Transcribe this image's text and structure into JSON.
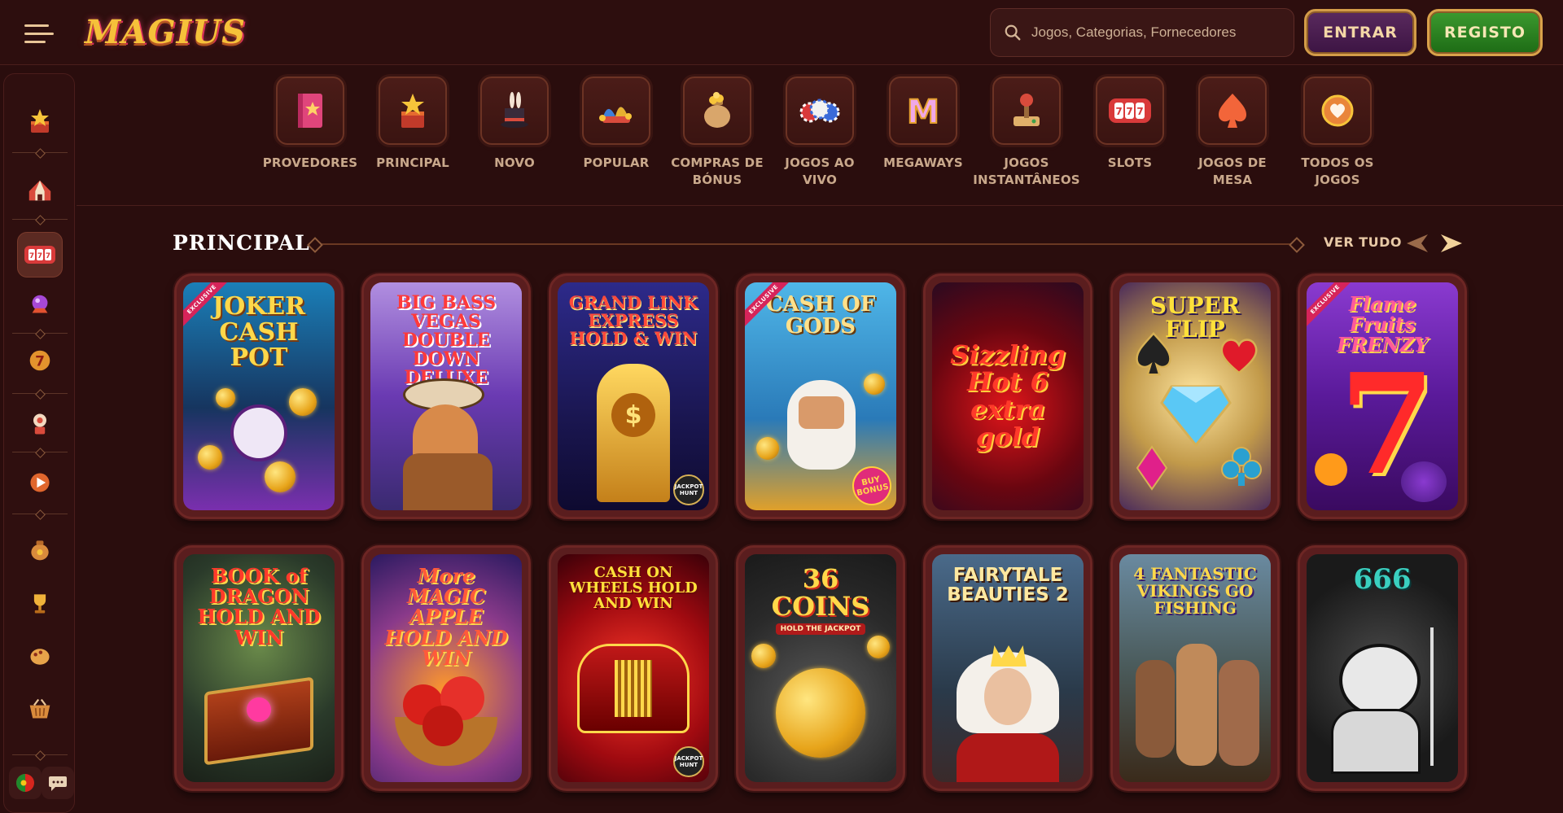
{
  "header": {
    "logo_text": "MAGIUS",
    "search_placeholder": "Jogos, Categorias, Fornecedores",
    "enter_label": "ENTRAR",
    "register_label": "REGISTO"
  },
  "categories": [
    {
      "label": "PROVEDORES",
      "icon": "book-star-icon"
    },
    {
      "label": "PRINCIPAL",
      "icon": "jack-in-box-icon"
    },
    {
      "label": "NOVO",
      "icon": "magic-hat-icon"
    },
    {
      "label": "POPULAR",
      "icon": "jester-hat-icon"
    },
    {
      "label": "COMPRAS DE BÓNUS",
      "icon": "coin-bag-icon"
    },
    {
      "label": "JOGOS AO VIVO",
      "icon": "poker-chips-icon"
    },
    {
      "label": "MEGAWAYS",
      "icon": "megaways-m-icon"
    },
    {
      "label": "JOGOS INSTANTÂNEOS",
      "icon": "joystick-icon"
    },
    {
      "label": "SLOTS",
      "icon": "slot-reels-icon"
    },
    {
      "label": "JOGOS DE MESA",
      "icon": "spade-icon"
    },
    {
      "label": "TODOS OS JOGOS",
      "icon": "heart-chip-icon"
    }
  ],
  "section": {
    "title": "PRINCIPAL",
    "see_all": "VER TUDO"
  },
  "games": [
    {
      "title": "JOKER CASH POT",
      "exclusive": "EXCLUSIVE"
    },
    {
      "title": "BIG BASS VEGAS DOUBLE DOWN DELUXE"
    },
    {
      "title": "GRAND LINK EXPRESS HOLD & WIN",
      "badge": "JACKPOT HUNT"
    },
    {
      "title": "CASH OF GODS",
      "exclusive": "EXCLUSIVE",
      "badge": "BUY BONUS"
    },
    {
      "title": "Sizzling Hot 6 extra gold"
    },
    {
      "title": "SUPER FLIP"
    },
    {
      "title": "Flame Fruits FRENZY",
      "exclusive": "EXCLUSIVE"
    },
    {
      "title": "BOOK of DRAGON HOLD AND WIN"
    },
    {
      "title": "More MAGIC APPLE HOLD AND WIN"
    },
    {
      "title": "CASH ON WHEELS HOLD AND WIN",
      "badge": "JACKPOT HUNT"
    },
    {
      "title": "36 COINS",
      "subtitle": "HOLD THE JACKPOT"
    },
    {
      "title": "FAIRYTALE BEAUTIES 2"
    },
    {
      "title": "4 FANTASTIC VIKINGS GO FISHING"
    },
    {
      "title": "666"
    }
  ],
  "colors": {
    "background": "#2a0d0d",
    "accent_gold": "#e8c597",
    "enter_button": "#4a1f50",
    "register_button": "#2e8a23"
  }
}
